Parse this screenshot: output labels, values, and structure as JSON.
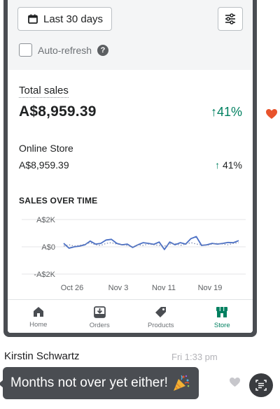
{
  "filters": {
    "date_range_label": "Last 30 days",
    "auto_refresh_label": "Auto-refresh",
    "auto_refresh_checked": false,
    "help_glyph": "?"
  },
  "total_sales": {
    "title": "Total sales",
    "value": "A$8,959.39",
    "change": "41%",
    "change_arrow": "↑"
  },
  "breakdown": {
    "channel": "Online Store",
    "value": "A$8,959.39",
    "change": "41%",
    "change_arrow": "↑"
  },
  "chart_title": "SALES OVER TIME",
  "chart_data": {
    "type": "line",
    "ylim": [
      -2000,
      2000
    ],
    "y_tick_labels": [
      "A$2K",
      "A$0",
      "-A$2K"
    ],
    "x_tick_labels": [
      "Oct 26",
      "Nov 3",
      "Nov 11",
      "Nov 19"
    ],
    "series": [
      {
        "style": "solid",
        "values": [
          250,
          -100,
          0,
          50,
          150,
          420,
          200,
          250,
          500,
          550,
          250,
          150,
          200,
          -50,
          150,
          300,
          250,
          180,
          350,
          -200,
          350,
          150,
          300,
          200,
          600,
          750,
          100,
          150,
          250,
          200,
          250,
          320,
          300,
          450
        ]
      },
      {
        "style": "dotted",
        "values": [
          50,
          150,
          50,
          100,
          200,
          300,
          150,
          100,
          250,
          300,
          200,
          150,
          100,
          0,
          150,
          100,
          200,
          150,
          100,
          50,
          200,
          250,
          100,
          200,
          300,
          200,
          150,
          100,
          200,
          250,
          200,
          150,
          250,
          300
        ]
      }
    ],
    "colors": {
      "solid": "#4a6fc4",
      "dotted": "#7c89b0"
    }
  },
  "nav": [
    {
      "label": "Home",
      "icon": "home-icon",
      "active": false
    },
    {
      "label": "Orders",
      "icon": "orders-icon",
      "active": false
    },
    {
      "label": "Products",
      "icon": "products-tag-icon",
      "active": false
    },
    {
      "label": "Store",
      "icon": "store-icon",
      "active": true
    }
  ],
  "chat": {
    "sender": "Kirstin Schwartz",
    "time": "Fri 1:33 pm",
    "message": "Months not over yet either!",
    "message_emoji": "party-popper-icon"
  },
  "colors": {
    "accent_green": "#008060",
    "heart_red": "#e8532c",
    "bubble_bg": "#4a4d52"
  }
}
